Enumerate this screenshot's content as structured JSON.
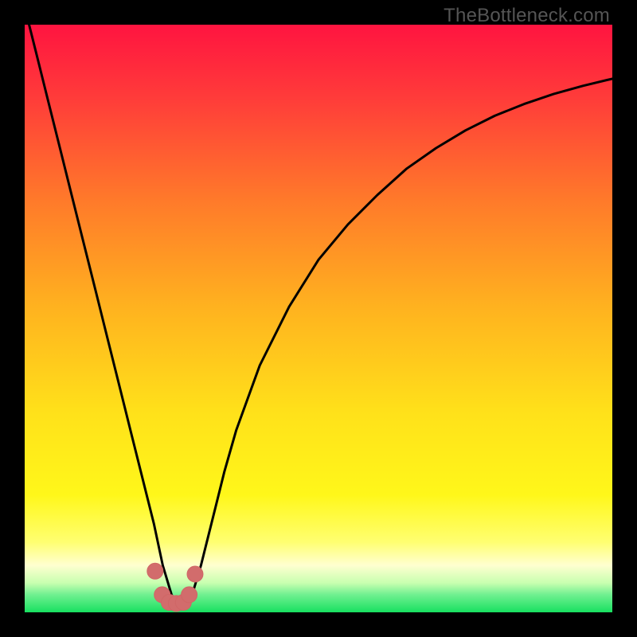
{
  "watermark": "TheBottleneck.com",
  "colors": {
    "black": "#000000",
    "curve": "#000000",
    "marker_fill": "#d26c6c",
    "marker_stroke": "#d06666",
    "grad_top": "#ff1a40",
    "grad_mid1": "#ff6a2a",
    "grad_mid2": "#ffbf1f",
    "grad_mid3": "#fff31a",
    "grad_pale": "#ffffc0",
    "grad_green": "#18e060"
  },
  "chart_data": {
    "type": "line",
    "title": "",
    "xlabel": "",
    "ylabel": "",
    "xlim": [
      0,
      100
    ],
    "ylim": [
      0,
      100
    ],
    "notes": "V-shaped bottleneck curve. Values estimated from pixel positions; no axis ticks or numeric labels are shown in the image.",
    "series": [
      {
        "name": "bottleneck-curve",
        "x": [
          0,
          2,
          4,
          6,
          8,
          10,
          12,
          14,
          16,
          18,
          20,
          22,
          23.5,
          25,
          26,
          27,
          28.5,
          30,
          32,
          34,
          36,
          40,
          45,
          50,
          55,
          60,
          65,
          70,
          75,
          80,
          85,
          90,
          95,
          100
        ],
        "y": [
          103,
          95,
          87,
          79,
          71,
          63,
          55,
          47,
          39,
          31,
          23,
          15,
          8,
          3,
          1.5,
          1.5,
          3,
          8,
          16,
          24,
          31,
          42,
          52,
          60,
          66,
          71,
          75.5,
          79,
          82,
          84.5,
          86.5,
          88.2,
          89.6,
          90.8
        ]
      }
    ],
    "markers": {
      "name": "highlight-cluster",
      "x": [
        22.2,
        23.4,
        24.6,
        25.8,
        27.0,
        28.0,
        29.0
      ],
      "y": [
        7.0,
        3.0,
        1.7,
        1.5,
        1.7,
        3.0,
        6.5
      ]
    }
  }
}
